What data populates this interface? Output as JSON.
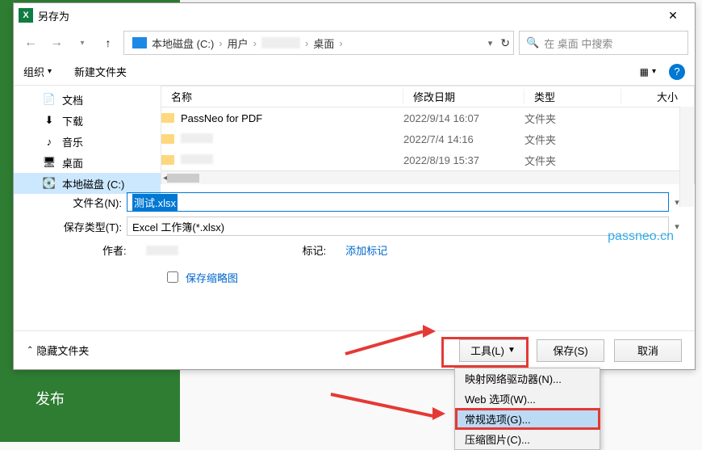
{
  "dialog": {
    "title": "另存为"
  },
  "background_sidebar": {
    "publish": "发布"
  },
  "address": {
    "root": "本地磁盘 (C:)",
    "user": "用户",
    "desktop": "桌面",
    "refresh": "↻"
  },
  "search": {
    "placeholder": "在 桌面 中搜索",
    "icon": "🔍"
  },
  "toolbar": {
    "organize": "组织",
    "new_folder": "新建文件夹",
    "help": "?"
  },
  "tree": {
    "items": [
      {
        "label": "文档",
        "icon": "📄"
      },
      {
        "label": "下载",
        "icon": "⬇"
      },
      {
        "label": "音乐",
        "icon": "♪"
      },
      {
        "label": "桌面",
        "icon": "🖥"
      },
      {
        "label": "本地磁盘 (C:)",
        "icon": "💽",
        "selected": true
      }
    ]
  },
  "columns": {
    "name": "名称",
    "date": "修改日期",
    "type": "类型",
    "size": "大小"
  },
  "rows": [
    {
      "name": "PassNeo for PDF",
      "date": "2022/9/14 16:07",
      "type": "文件夹"
    },
    {
      "name": "",
      "date": "2022/7/4 14:16",
      "type": "文件夹"
    },
    {
      "name": "",
      "date": "2022/8/19 15:37",
      "type": "文件夹"
    }
  ],
  "form": {
    "filename_label": "文件名(N):",
    "filename_value": "测试.xlsx",
    "type_label": "保存类型(T):",
    "type_value": "Excel 工作簿(*.xlsx)",
    "author_label": "作者:",
    "tag_label": "标记:",
    "tag_value": "添加标记",
    "thumb": "保存缩略图"
  },
  "buttons": {
    "hide_folders": "隐藏文件夹",
    "tools": "工具(L)",
    "save": "保存(S)",
    "cancel": "取消"
  },
  "menu": {
    "items": [
      {
        "label": "映射网络驱动器(N)..."
      },
      {
        "label": "Web 选项(W)..."
      },
      {
        "label": "常规选项(G)...",
        "highlighted": true
      },
      {
        "label": "压缩图片(C)..."
      }
    ]
  },
  "watermark": "passneo.cn"
}
